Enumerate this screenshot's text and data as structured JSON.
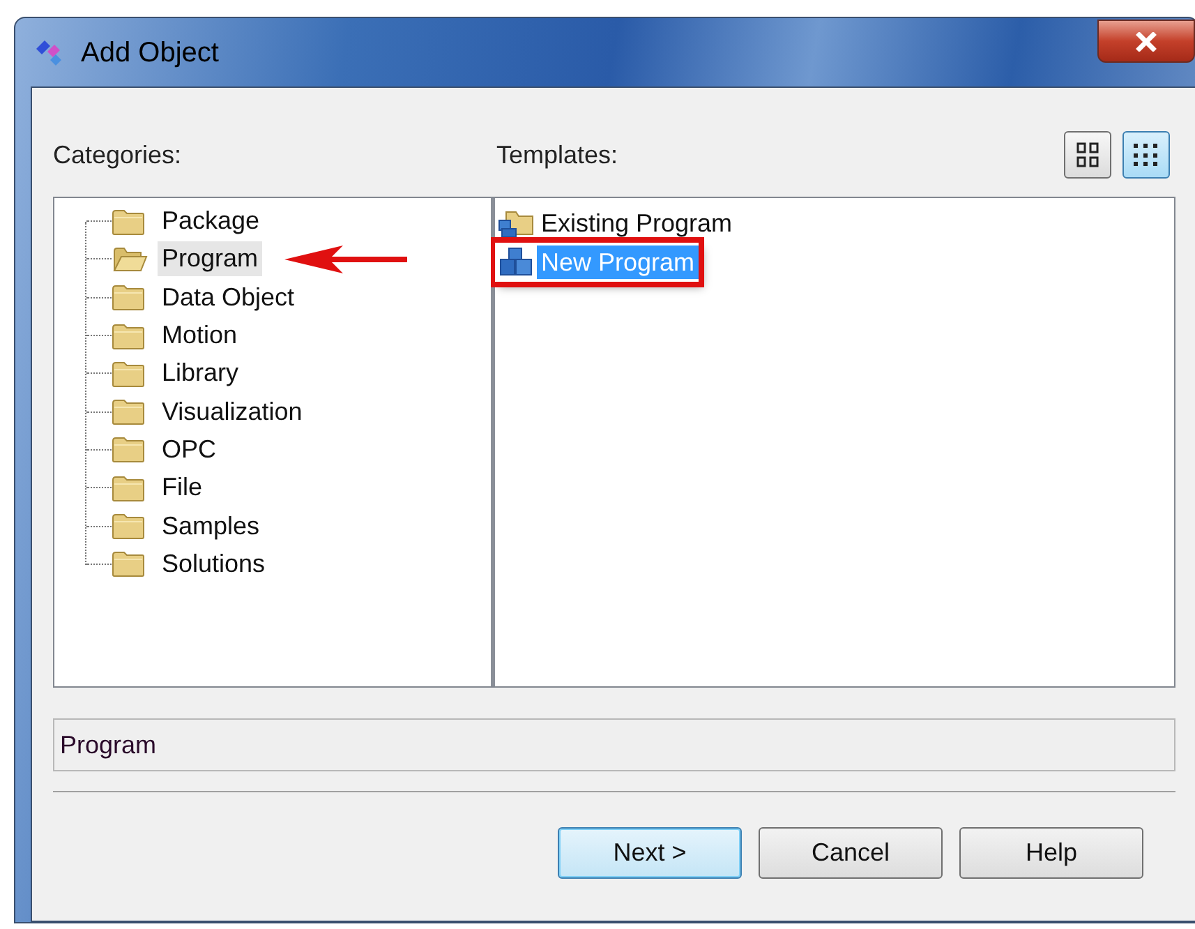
{
  "window": {
    "title": "Add Object"
  },
  "categories": {
    "label": "Categories:",
    "items": [
      {
        "label": "Package",
        "selected": false
      },
      {
        "label": "Program",
        "selected": true
      },
      {
        "label": "Data Object",
        "selected": false
      },
      {
        "label": "Motion",
        "selected": false
      },
      {
        "label": "Library",
        "selected": false
      },
      {
        "label": "Visualization",
        "selected": false
      },
      {
        "label": "OPC",
        "selected": false
      },
      {
        "label": "File",
        "selected": false
      },
      {
        "label": "Samples",
        "selected": false
      },
      {
        "label": "Solutions",
        "selected": false
      }
    ]
  },
  "templates": {
    "label": "Templates:",
    "view_buttons": [
      {
        "kind": "large",
        "selected": false
      },
      {
        "kind": "list",
        "selected": true
      }
    ],
    "items": [
      {
        "label": "Existing Program",
        "kind": "existing",
        "selected": false
      },
      {
        "label": "New Program",
        "kind": "new",
        "selected": true
      }
    ]
  },
  "description": "Program",
  "buttons": [
    {
      "label": "Next >",
      "default": true
    },
    {
      "label": "Cancel",
      "default": false
    },
    {
      "label": "Help",
      "default": false
    }
  ]
}
